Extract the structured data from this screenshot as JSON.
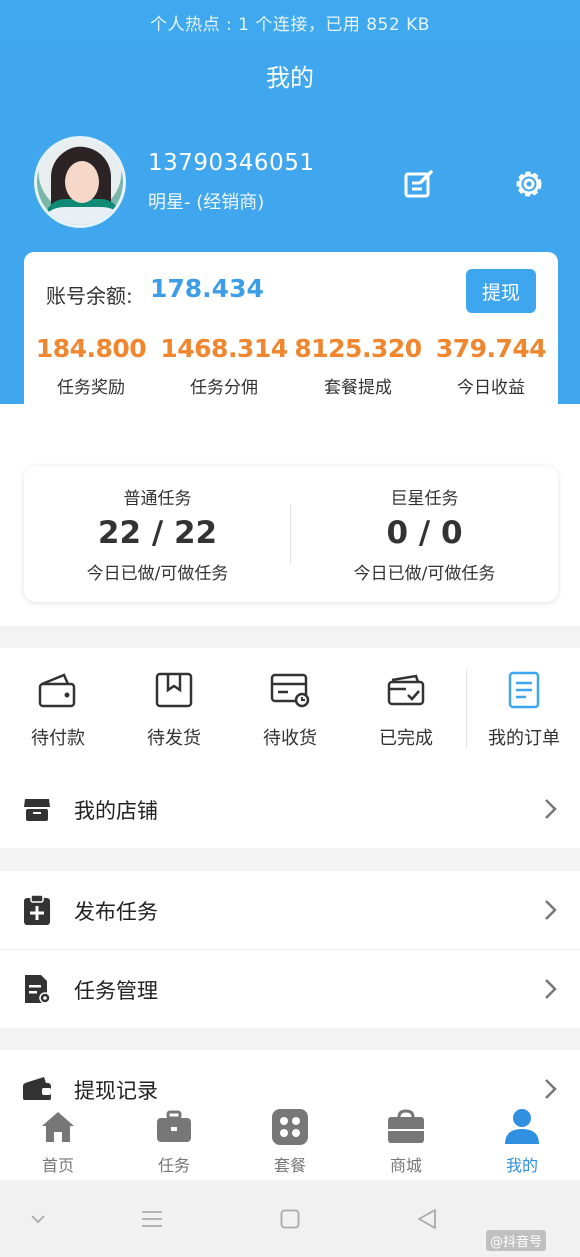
{
  "status_bar": {
    "hotspot_text": "个人热点 : 1 个连接，已用 852 KB"
  },
  "header": {
    "title": "我的"
  },
  "profile": {
    "phone": "13790346051",
    "role": "明星- (经销商)"
  },
  "balance": {
    "label": "账号余额:",
    "value": "178.434",
    "withdraw_label": "提现",
    "stats": [
      {
        "value": "184.800",
        "label": "任务奖励"
      },
      {
        "value": "1468.314",
        "label": "任务分佣"
      },
      {
        "value": "8125.320",
        "label": "套餐提成"
      },
      {
        "value": "379.744",
        "label": "今日收益"
      }
    ]
  },
  "tasks": [
    {
      "title": "普通任务",
      "count": "22 / 22",
      "sub": "今日已做/可做任务"
    },
    {
      "title": "巨星任务",
      "count": "0 / 0",
      "sub": "今日已做/可做任务"
    }
  ],
  "orders": [
    {
      "label": "待付款",
      "icon": "wallet-icon"
    },
    {
      "label": "待发货",
      "icon": "package-icon"
    },
    {
      "label": "待收货",
      "icon": "card-clock-icon"
    },
    {
      "label": "已完成",
      "icon": "completed-icon"
    },
    {
      "label": "我的订单",
      "icon": "order-list-icon"
    }
  ],
  "menu": [
    {
      "label": "我的店铺",
      "icon": "store-icon"
    },
    {
      "label": "发布任务",
      "icon": "clipboard-add-icon"
    },
    {
      "label": "任务管理",
      "icon": "file-gear-icon"
    },
    {
      "label": "提现记录",
      "icon": "wallet-record-icon"
    }
  ],
  "tabbar": [
    {
      "label": "首页",
      "icon": "home-icon"
    },
    {
      "label": "任务",
      "icon": "briefcase-icon"
    },
    {
      "label": "套餐",
      "icon": "grid-icon"
    },
    {
      "label": "商城",
      "icon": "shop-bag-icon"
    },
    {
      "label": "我的",
      "icon": "user-icon",
      "active": true
    }
  ],
  "watermark": "@抖音号",
  "colors": {
    "primary": "#40a6ee",
    "accent_orange": "#f0872f",
    "balance_blue": "#3d9ee7",
    "active_tab": "#2f8fe0"
  }
}
